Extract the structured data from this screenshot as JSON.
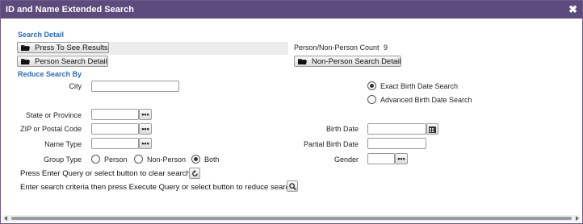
{
  "dialog": {
    "title": "ID and Name Extended Search",
    "close_icon": "close-icon"
  },
  "search_detail": {
    "section_title": "Search Detail",
    "press_to_see_results": "Press To See Results",
    "person_search_detail": "Person Search Detail",
    "non_person_search_detail": "Non-Person Search Detail",
    "count_label": "Person/Non-Person Count",
    "count_value": "9"
  },
  "reduce_search": {
    "section_title": "Reduce Search By",
    "city_label": "City",
    "city_value": "",
    "state_label": "State or Province",
    "state_value": "",
    "zip_label": "ZIP or Postal Code",
    "zip_value": "",
    "name_type_label": "Name Type",
    "name_type_value": "",
    "group_type_label": "Group Type",
    "group_type_options": [
      "Person",
      "Non-Person",
      "Both"
    ],
    "group_type_selected": "Both",
    "birth_date_mode_options": [
      "Exact Birth Date Search",
      "Advanced Birth Date Search"
    ],
    "birth_date_mode_selected": "Exact Birth Date Search",
    "birth_date_label": "Birth Date",
    "birth_date_value": "",
    "partial_birth_date_label": "Partial Birth Date",
    "partial_birth_date_value": "",
    "gender_label": "Gender",
    "gender_value": "",
    "lookup_button_glyph": "•••"
  },
  "instructions": {
    "clear_text": "Press Enter Query or select button to clear search.",
    "execute_text": "Enter search criteria then press Execute Query or select button to reduce search."
  },
  "icons": {
    "folder": "folder-icon",
    "refresh": "refresh-icon",
    "search": "search-icon",
    "calendar": "calendar-icon"
  }
}
